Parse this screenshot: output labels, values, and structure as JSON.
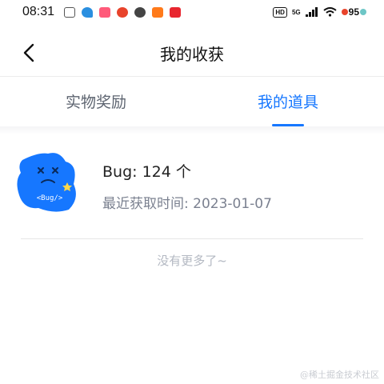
{
  "status_bar": {
    "time": "08:31",
    "hd": "HD",
    "network": "5G",
    "battery": "95"
  },
  "nav": {
    "title": "我的收获",
    "back_icon": "chevron-left-icon"
  },
  "tabs": [
    {
      "label": "实物奖励",
      "active": false
    },
    {
      "label": "我的道具",
      "active": true
    }
  ],
  "accent_color": "#1677ff",
  "items": [
    {
      "name": "Bug:  124 个",
      "acquired": "最近获取时间: 2023-01-07",
      "image_label": "<Bug/>"
    }
  ],
  "footer": {
    "no_more": "没有更多了~"
  },
  "watermark": "@稀土掘金技术社区"
}
